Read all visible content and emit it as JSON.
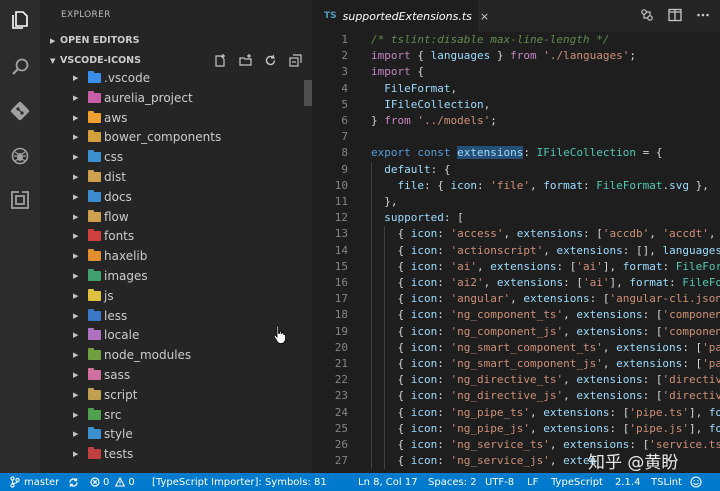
{
  "activity_bar": {
    "icons": [
      "files-icon",
      "search-icon",
      "source-control-icon",
      "debug-icon",
      "extensions-icon"
    ]
  },
  "sidebar": {
    "title": "EXPLORER",
    "open_editors_label": "OPEN EDITORS",
    "folder_label": "VSCODE-ICONS",
    "section_actions": [
      "new-file-icon",
      "new-folder-icon",
      "refresh-icon",
      "collapse-all-icon"
    ],
    "tree": [
      {
        "name": ".vscode",
        "color": "#3b8eea"
      },
      {
        "name": "aurelia_project",
        "color": "#c85ea8"
      },
      {
        "name": "aws",
        "color": "#f0a030"
      },
      {
        "name": "bower_components",
        "color": "#d2a03c"
      },
      {
        "name": "css",
        "color": "#3c90d0"
      },
      {
        "name": "dist",
        "color": "#d0a050"
      },
      {
        "name": "docs",
        "color": "#3c8cd0"
      },
      {
        "name": "flow",
        "color": "#d0a050"
      },
      {
        "name": "fonts",
        "color": "#d04040"
      },
      {
        "name": "haxelib",
        "color": "#e09030"
      },
      {
        "name": "images",
        "color": "#40a070"
      },
      {
        "name": "js",
        "color": "#e0c040"
      },
      {
        "name": "less",
        "color": "#3c78c8"
      },
      {
        "name": "locale",
        "color": "#b070c0"
      },
      {
        "name": "node_modules",
        "color": "#70a040"
      },
      {
        "name": "sass",
        "color": "#d070a0"
      },
      {
        "name": "script",
        "color": "#c0a050"
      },
      {
        "name": "src",
        "color": "#50a050"
      },
      {
        "name": "style",
        "color": "#3c90d0"
      },
      {
        "name": "tests",
        "color": "#c04040"
      }
    ]
  },
  "tab": {
    "lang_badge": "TS",
    "filename": "supportedExtensions.ts",
    "close_glyph": "×"
  },
  "editor_actions": [
    "open-changes-icon",
    "split-editor-icon",
    "more-actions-icon"
  ],
  "code": {
    "line_numbers": [
      "1",
      "2",
      "3",
      "4",
      "5",
      "6",
      "7",
      "8",
      "9",
      "10",
      "11",
      "12",
      "13",
      "14",
      "15",
      "16",
      "17",
      "18",
      "19",
      "20",
      "21",
      "22",
      "23",
      "24",
      "25",
      "26",
      "27"
    ],
    "lines": [
      [
        [
          "c",
          "/* tslint:disable max-line-length */"
        ]
      ],
      [
        [
          "k",
          "import"
        ],
        [
          "p",
          " { "
        ],
        [
          "v",
          "languages"
        ],
        [
          "p",
          " } "
        ],
        [
          "k",
          "from"
        ],
        [
          "p",
          " "
        ],
        [
          "s",
          "'./languages'"
        ],
        [
          "p",
          ";"
        ]
      ],
      [
        [
          "k",
          "import"
        ],
        [
          "p",
          " {"
        ]
      ],
      [
        [
          "p",
          "  "
        ],
        [
          "v",
          "FileFormat"
        ],
        [
          "p",
          ","
        ]
      ],
      [
        [
          "p",
          "  "
        ],
        [
          "v",
          "IFileCollection"
        ],
        [
          "p",
          ","
        ]
      ],
      [
        [
          "p",
          "} "
        ],
        [
          "k",
          "from"
        ],
        [
          "p",
          " "
        ],
        [
          "s",
          "'../models'"
        ],
        [
          "p",
          ";"
        ]
      ],
      [
        [
          "p",
          ""
        ]
      ],
      [
        [
          "k2",
          "export"
        ],
        [
          "p",
          " "
        ],
        [
          "k2",
          "const"
        ],
        [
          "p",
          " "
        ],
        [
          "h",
          "extensions"
        ],
        [
          "p",
          ": "
        ],
        [
          "t",
          "IFileCollection"
        ],
        [
          "p",
          " = {"
        ]
      ],
      [
        [
          "p",
          "  "
        ],
        [
          "v",
          "default"
        ],
        [
          "p",
          ": {"
        ]
      ],
      [
        [
          "p",
          "    "
        ],
        [
          "v",
          "file"
        ],
        [
          "p",
          ": { "
        ],
        [
          "v",
          "icon"
        ],
        [
          "p",
          ": "
        ],
        [
          "s",
          "'file'"
        ],
        [
          "p",
          ", "
        ],
        [
          "v",
          "format"
        ],
        [
          "p",
          ": "
        ],
        [
          "t",
          "FileFormat"
        ],
        [
          "p",
          "."
        ],
        [
          "v",
          "svg"
        ],
        [
          "p",
          " },"
        ]
      ],
      [
        [
          "p",
          "  },"
        ]
      ],
      [
        [
          "p",
          "  "
        ],
        [
          "v",
          "supported"
        ],
        [
          "p",
          ": ["
        ]
      ],
      [
        [
          "p",
          "    { "
        ],
        [
          "v",
          "icon"
        ],
        [
          "p",
          ": "
        ],
        [
          "s",
          "'access'"
        ],
        [
          "p",
          ", "
        ],
        [
          "v",
          "extensions"
        ],
        [
          "p",
          ": ["
        ],
        [
          "s",
          "'accdb'"
        ],
        [
          "p",
          ", "
        ],
        [
          "s",
          "'accdt'"
        ],
        [
          "p",
          ", "
        ],
        [
          "s",
          "'a"
        ]
      ],
      [
        [
          "p",
          "    { "
        ],
        [
          "v",
          "icon"
        ],
        [
          "p",
          ": "
        ],
        [
          "s",
          "'actionscript'"
        ],
        [
          "p",
          ", "
        ],
        [
          "v",
          "extensions"
        ],
        [
          "p",
          ": [], "
        ],
        [
          "v",
          "languages"
        ],
        [
          "p",
          ":"
        ]
      ],
      [
        [
          "p",
          "    { "
        ],
        [
          "v",
          "icon"
        ],
        [
          "p",
          ": "
        ],
        [
          "s",
          "'ai'"
        ],
        [
          "p",
          ", "
        ],
        [
          "v",
          "extensions"
        ],
        [
          "p",
          ": ["
        ],
        [
          "s",
          "'ai'"
        ],
        [
          "p",
          "], "
        ],
        [
          "v",
          "format"
        ],
        [
          "p",
          ": "
        ],
        [
          "t",
          "FileForm"
        ]
      ],
      [
        [
          "p",
          "    { "
        ],
        [
          "v",
          "icon"
        ],
        [
          "p",
          ": "
        ],
        [
          "s",
          "'ai2'"
        ],
        [
          "p",
          ", "
        ],
        [
          "v",
          "extensions"
        ],
        [
          "p",
          ": ["
        ],
        [
          "s",
          "'ai'"
        ],
        [
          "p",
          "], "
        ],
        [
          "v",
          "format"
        ],
        [
          "p",
          ": "
        ],
        [
          "t",
          "FileFo"
        ]
      ],
      [
        [
          "p",
          "    { "
        ],
        [
          "v",
          "icon"
        ],
        [
          "p",
          ": "
        ],
        [
          "s",
          "'angular'"
        ],
        [
          "p",
          ", "
        ],
        [
          "v",
          "extensions"
        ],
        [
          "p",
          ": ["
        ],
        [
          "s",
          "'angular-cli.json'"
        ]
      ],
      [
        [
          "p",
          "    { "
        ],
        [
          "v",
          "icon"
        ],
        [
          "p",
          ": "
        ],
        [
          "s",
          "'ng_component_ts'"
        ],
        [
          "p",
          ", "
        ],
        [
          "v",
          "extensions"
        ],
        [
          "p",
          ": ["
        ],
        [
          "s",
          "'component"
        ]
      ],
      [
        [
          "p",
          "    { "
        ],
        [
          "v",
          "icon"
        ],
        [
          "p",
          ": "
        ],
        [
          "s",
          "'ng_component_js'"
        ],
        [
          "p",
          ", "
        ],
        [
          "v",
          "extensions"
        ],
        [
          "p",
          ": ["
        ],
        [
          "s",
          "'component"
        ]
      ],
      [
        [
          "p",
          "    { "
        ],
        [
          "v",
          "icon"
        ],
        [
          "p",
          ": "
        ],
        [
          "s",
          "'ng_smart_component_ts'"
        ],
        [
          "p",
          ", "
        ],
        [
          "v",
          "extensions"
        ],
        [
          "p",
          ": ["
        ],
        [
          "s",
          "'pag"
        ]
      ],
      [
        [
          "p",
          "    { "
        ],
        [
          "v",
          "icon"
        ],
        [
          "p",
          ": "
        ],
        [
          "s",
          "'ng_smart_component_js'"
        ],
        [
          "p",
          ", "
        ],
        [
          "v",
          "extensions"
        ],
        [
          "p",
          ": ["
        ],
        [
          "s",
          "'pag"
        ]
      ],
      [
        [
          "p",
          "    { "
        ],
        [
          "v",
          "icon"
        ],
        [
          "p",
          ": "
        ],
        [
          "s",
          "'ng_directive_ts'"
        ],
        [
          "p",
          ", "
        ],
        [
          "v",
          "extensions"
        ],
        [
          "p",
          ": ["
        ],
        [
          "s",
          "'directive"
        ]
      ],
      [
        [
          "p",
          "    { "
        ],
        [
          "v",
          "icon"
        ],
        [
          "p",
          ": "
        ],
        [
          "s",
          "'ng_directive_js'"
        ],
        [
          "p",
          ", "
        ],
        [
          "v",
          "extensions"
        ],
        [
          "p",
          ": ["
        ],
        [
          "s",
          "'directive"
        ]
      ],
      [
        [
          "p",
          "    { "
        ],
        [
          "v",
          "icon"
        ],
        [
          "p",
          ": "
        ],
        [
          "s",
          "'ng_pipe_ts'"
        ],
        [
          "p",
          ", "
        ],
        [
          "v",
          "extensions"
        ],
        [
          "p",
          ": ["
        ],
        [
          "s",
          "'pipe.ts'"
        ],
        [
          "p",
          "], "
        ],
        [
          "v",
          "for"
        ]
      ],
      [
        [
          "p",
          "    { "
        ],
        [
          "v",
          "icon"
        ],
        [
          "p",
          ": "
        ],
        [
          "s",
          "'ng_pipe_js'"
        ],
        [
          "p",
          ", "
        ],
        [
          "v",
          "extensions"
        ],
        [
          "p",
          ": ["
        ],
        [
          "s",
          "'pipe.js'"
        ],
        [
          "p",
          "], "
        ],
        [
          "v",
          "for"
        ]
      ],
      [
        [
          "p",
          "    { "
        ],
        [
          "v",
          "icon"
        ],
        [
          "p",
          ": "
        ],
        [
          "s",
          "'ng_service_ts'"
        ],
        [
          "p",
          ", "
        ],
        [
          "v",
          "extensions"
        ],
        [
          "p",
          ": ["
        ],
        [
          "s",
          "'service.ts'"
        ]
      ],
      [
        [
          "p",
          "    { "
        ],
        [
          "v",
          "icon"
        ],
        [
          "p",
          ": "
        ],
        [
          "s",
          "'ng_service_js'"
        ],
        [
          "p",
          ", "
        ],
        [
          "v",
          "exten"
        ]
      ]
    ]
  },
  "statusbar": {
    "branch": "master",
    "errors": "0",
    "warnings": "0",
    "importer": "[TypeScript Importer]: Symbols: 81",
    "position": "Ln 8, Col 17",
    "spaces": "Spaces: 2",
    "encoding": "UTF-8",
    "eol": "LF",
    "language": "TypeScript",
    "version": "2.1.4",
    "linter": "TSLint"
  },
  "watermark": "知乎 @黄盼",
  "colors": {
    "accent": "#007acc",
    "editor_bg": "#1e1e1e",
    "sidebar_bg": "#252526",
    "activity_bg": "#2c2c2c"
  }
}
